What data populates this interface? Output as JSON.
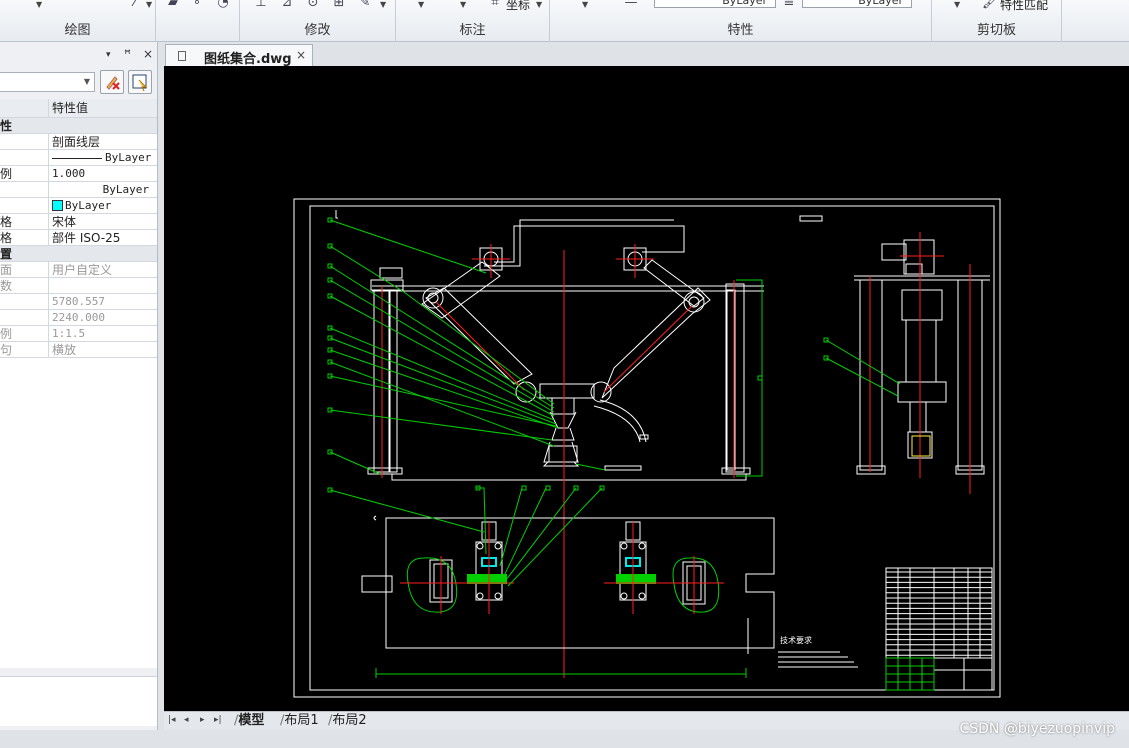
{
  "ribbon": {
    "groups": [
      {
        "label": "绘图"
      },
      {
        "label": "修改"
      },
      {
        "label": "标注"
      },
      {
        "label": "特性"
      },
      {
        "label": "剪切板"
      }
    ],
    "annotation_coord_label": "坐标",
    "linetype_combo_value": "ByLayer",
    "lineweight_combo_value": "ByLayer",
    "match_properties_label": "特性匹配"
  },
  "properties_panel": {
    "header_controls": {
      "dropdown": "▾",
      "pin": "ㅁ",
      "close": "×"
    },
    "columns": {
      "name": "",
      "value": "特性值"
    },
    "rows": [
      {
        "kind": "cat",
        "name": "性",
        "value": ""
      },
      {
        "kind": "item",
        "name": "",
        "value": "剖面线层"
      },
      {
        "kind": "line",
        "name": "",
        "value": "ByLayer"
      },
      {
        "kind": "item",
        "name": "例",
        "value": "1.000"
      },
      {
        "kind": "right",
        "name": "",
        "value": "ByLayer"
      },
      {
        "kind": "color",
        "name": "",
        "value": "ByLayer"
      },
      {
        "kind": "item",
        "name": "格",
        "value": "宋体"
      },
      {
        "kind": "item",
        "name": "格",
        "value": "部件 ISO-25"
      },
      {
        "kind": "cat",
        "name": "置",
        "value": ""
      },
      {
        "kind": "dis",
        "name": "面",
        "value": "用户自定义"
      },
      {
        "kind": "dis",
        "name": "数",
        "value": ""
      },
      {
        "kind": "dis",
        "name": "",
        "value": "5780.557"
      },
      {
        "kind": "dis",
        "name": "",
        "value": "2240.000"
      },
      {
        "kind": "dis",
        "name": "例",
        "value": "1:1.5"
      },
      {
        "kind": "dis",
        "name": "句",
        "value": "横放"
      }
    ]
  },
  "document": {
    "tab_title": "图纸集合.dwg",
    "tab_close": "×"
  },
  "drawing": {
    "tech_requirements": "技术要求",
    "colors": {
      "background": "#000000",
      "frame": "#ffffff",
      "leader": "#00ff00",
      "center": "#ff0000",
      "hatch": "#00ff00",
      "cyan": "#00ffff"
    }
  },
  "layout_tabs": {
    "nav": [
      "|◂",
      "◂",
      "▸",
      "▸|"
    ],
    "tabs": [
      "模型",
      "布局1",
      "布局2"
    ]
  },
  "watermark": "CSDN @biyezuopinvip"
}
